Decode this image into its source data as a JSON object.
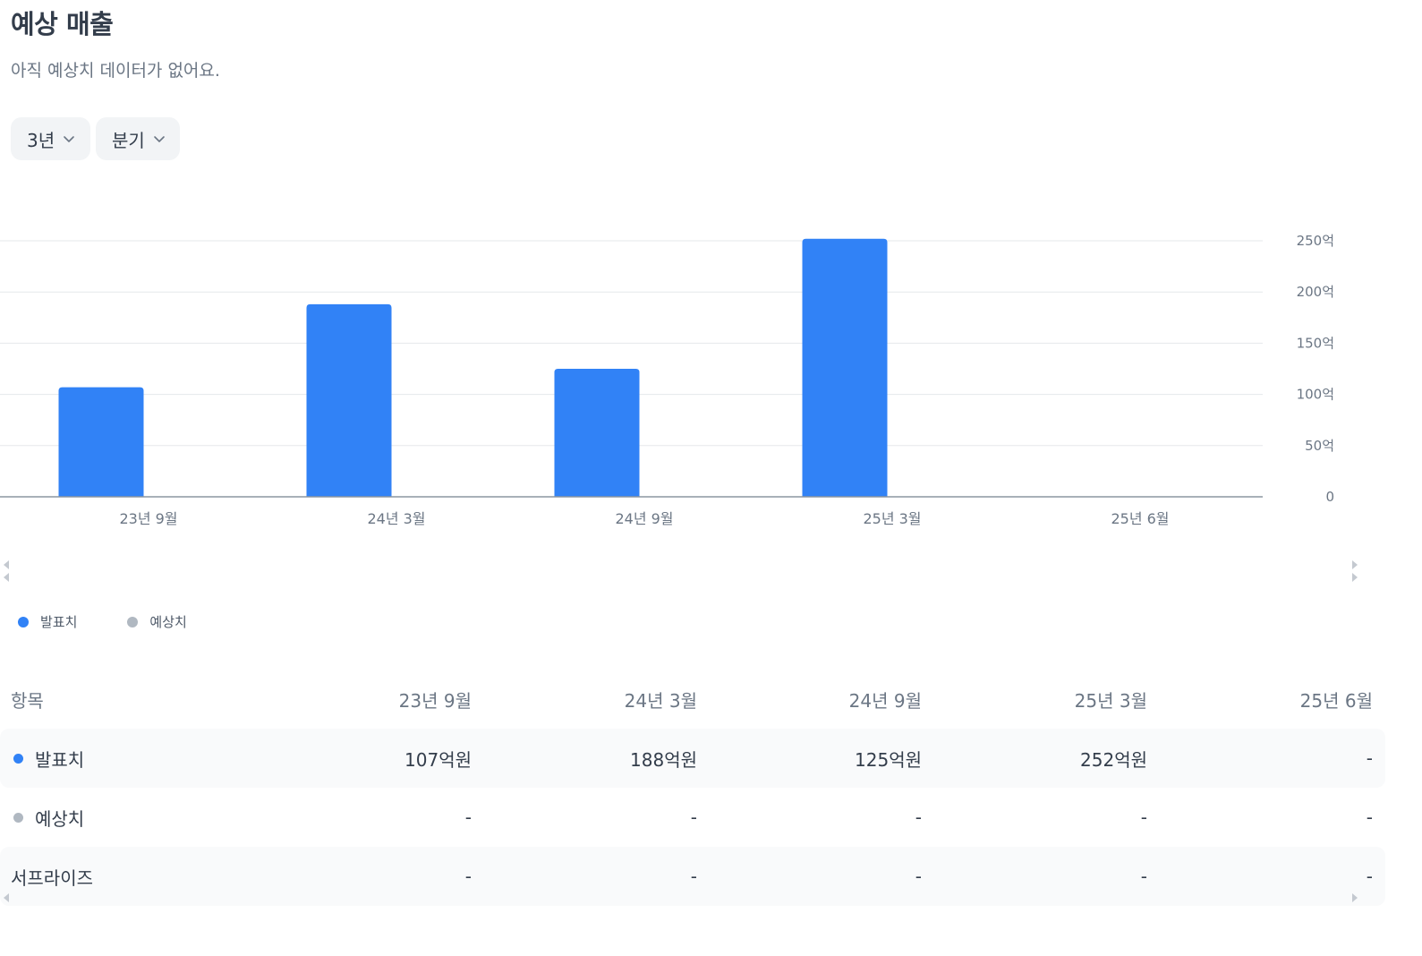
{
  "header": {
    "title": "예상 매출",
    "subtitle": "아직 예상치 데이터가 없어요."
  },
  "filters": {
    "period": "3년",
    "unit": "분기"
  },
  "colors": {
    "reported": "#3182f6",
    "estimate": "#b0b8c1"
  },
  "chart_data": {
    "type": "bar",
    "categories": [
      "23년 9월",
      "24년 3월",
      "24년 9월",
      "25년 3월",
      "25년 6월"
    ],
    "series": [
      {
        "name": "발표치",
        "values": [
          107,
          188,
          125,
          252,
          null
        ]
      },
      {
        "name": "예상치",
        "values": [
          null,
          null,
          null,
          null,
          null
        ]
      }
    ],
    "ylim": [
      0,
      250
    ],
    "yticks": [
      0,
      50,
      100,
      150,
      200,
      250
    ],
    "ytick_labels": [
      "0",
      "50억",
      "100억",
      "150억",
      "200억",
      "250억"
    ],
    "y_axis_position": "right",
    "grid": true,
    "legend": "bottom-left"
  },
  "legend": [
    {
      "label": "발표치",
      "color": "#3182f6"
    },
    {
      "label": "예상치",
      "color": "#b0b8c1"
    }
  ],
  "table": {
    "header_label": "항목",
    "columns": [
      "23년 9월",
      "24년 3월",
      "24년 9월",
      "25년 3월",
      "25년 6월"
    ],
    "rows": [
      {
        "label": "발표치",
        "values": [
          "107억원",
          "188억원",
          "125억원",
          "252억원",
          "-"
        ]
      },
      {
        "label": "예상치",
        "values": [
          "-",
          "-",
          "-",
          "-",
          "-"
        ]
      },
      {
        "label": "서프라이즈",
        "values": [
          "-",
          "-",
          "-",
          "-",
          "-"
        ]
      }
    ]
  }
}
